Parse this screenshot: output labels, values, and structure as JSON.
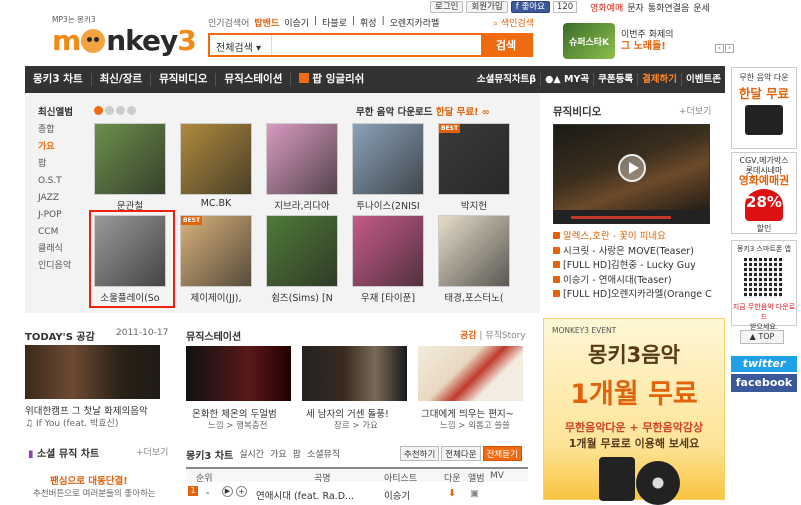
{
  "top": {
    "login": "로그인",
    "join": "회원가입",
    "like": "좋아요",
    "like_count": "120",
    "menu": [
      "영화예매",
      "문자",
      "통화연결음",
      "운세"
    ]
  },
  "logo": {
    "tagline": "MP3는 몽키3",
    "text_a": "m",
    "text_b": "nkey",
    "text_c": "3"
  },
  "search": {
    "popular_label": "인기검색어",
    "popular_hot": "탑밴드",
    "popular": [
      "이승기",
      "타블로",
      "휘성",
      "오렌지카라멜"
    ],
    "color_search": "색인검색",
    "category": "전체검색",
    "placeholder": "",
    "button": "검색"
  },
  "top_banner": {
    "img_text": "슈퍼스타K",
    "line1": "이번주 화제의",
    "line2": "그 노래들!"
  },
  "nav": {
    "items": [
      "몽키3 차트",
      "최신/장르",
      "뮤직비디오",
      "뮤직스테이션",
      "팝 잉글리쉬"
    ],
    "right": [
      "소셜뮤직차트β",
      "MY곡",
      "쿠폰등록",
      "결제하기",
      "이벤트존"
    ]
  },
  "albums": {
    "title": "최신앨범",
    "promo_a": "무한 음악 다운로드",
    "promo_b": "한달 무료!",
    "genres": [
      "종합",
      "가요",
      "팝",
      "O.S.T",
      "JAZZ",
      "J-POP",
      "CCM",
      "클래식",
      "인디음악"
    ],
    "selected_genre": "가요",
    "items": [
      {
        "title": "문관철",
        "color": "#6b8f4a"
      },
      {
        "title": "MC.BK",
        "color": "#b08a3c"
      },
      {
        "title": "지브라,리다아",
        "color": "#d89ac0"
      },
      {
        "title": "투나이스(2NISI",
        "color": "#8aa2b8"
      },
      {
        "title": "박지헌",
        "color": "#3a3a3a"
      },
      {
        "title": "소울플레이(So",
        "color": "#9a9a9a"
      },
      {
        "title": "제이제이(JJ),",
        "color": "#d9b27a"
      },
      {
        "title": "쉼즈(Sims) [N",
        "color": "#4f7a38"
      },
      {
        "title": "우재 [타이푼]",
        "color": "#c65a8a"
      },
      {
        "title": "태경,포스터노(",
        "color": "#e6dcc8"
      }
    ],
    "best_badge": "BEST"
  },
  "music_video": {
    "title": "뮤직비디오",
    "more": "+더보기",
    "list": [
      "알렉스,호란 - 꽃이 피네요",
      "시크릿 - 사랑은 MOVE(Teaser)",
      "[FULL HD]김현중 - Lucky Guy",
      "이승기 - 연애시대(Teaser)",
      "[FULL HD]오렌지카라멜(Orange C"
    ]
  },
  "side": {
    "ad1_a": "무한 음악 다운",
    "ad1_b": "한달 무료",
    "ad2_a": "CGV,메가박스",
    "ad2_b": "롯데시네마",
    "ad2_c": "영화예매권",
    "ad2_d": "28%",
    "ad2_e": "할인",
    "qr_a": "몽키3 스마트폰 앱",
    "qr_b": "지금 무한음악 다운로드",
    "qr_c": "받으세요.",
    "top": "TOP",
    "twitter": "twitter",
    "facebook": "facebook"
  },
  "today": {
    "title": "TODAY'S 공감",
    "date": "2011-10-17",
    "caption": "위대한캠프 그 첫날 화제의음악",
    "sub": "If You (feat. 박효신)"
  },
  "soul_chart": {
    "title": "소셜 뮤직 차트",
    "more": "+더보기",
    "line1": "팬심으로 대동단결!",
    "line2": "추천버튼으로 여러분들의 좋아하는"
  },
  "station": {
    "title": "뮤직스테이션",
    "tab_a": "공감",
    "tab_b": "뮤직Story",
    "items": [
      {
        "caption": "온화한 체온의 두얼범",
        "sub": "느낌 > 행복충전"
      },
      {
        "caption": "세 남자의 거센 돌풍!",
        "sub": "장르 > 가요"
      },
      {
        "caption": "그대에게 띄우는 편지~",
        "sub": "느낌 > 외롭고 쓸쓸"
      }
    ]
  },
  "chart": {
    "title": "몽키3 차트",
    "tabs": [
      "실시간",
      "가요",
      "팝",
      "소셜뮤직"
    ],
    "selected_tab": "실시간",
    "btns": [
      "추천하기",
      "전체다운",
      "전체듣기"
    ],
    "head": {
      "rank": "순위",
      "song": "곡명",
      "artist": "아티스트",
      "down": "다운",
      "album": "앨범",
      "mv": "MV"
    },
    "row": {
      "rank": "1",
      "change": "-",
      "song": "연애시대 (feat. Ra.D...",
      "artist": "이승기"
    }
  },
  "event": {
    "label": "MONKEY3 EVENT",
    "line1": "몽키3음악",
    "line2": "1개월 무료",
    "line3": "무한음악다운 + 무한음악감상",
    "line4": "1개월 무료로 이용해 보세요"
  }
}
